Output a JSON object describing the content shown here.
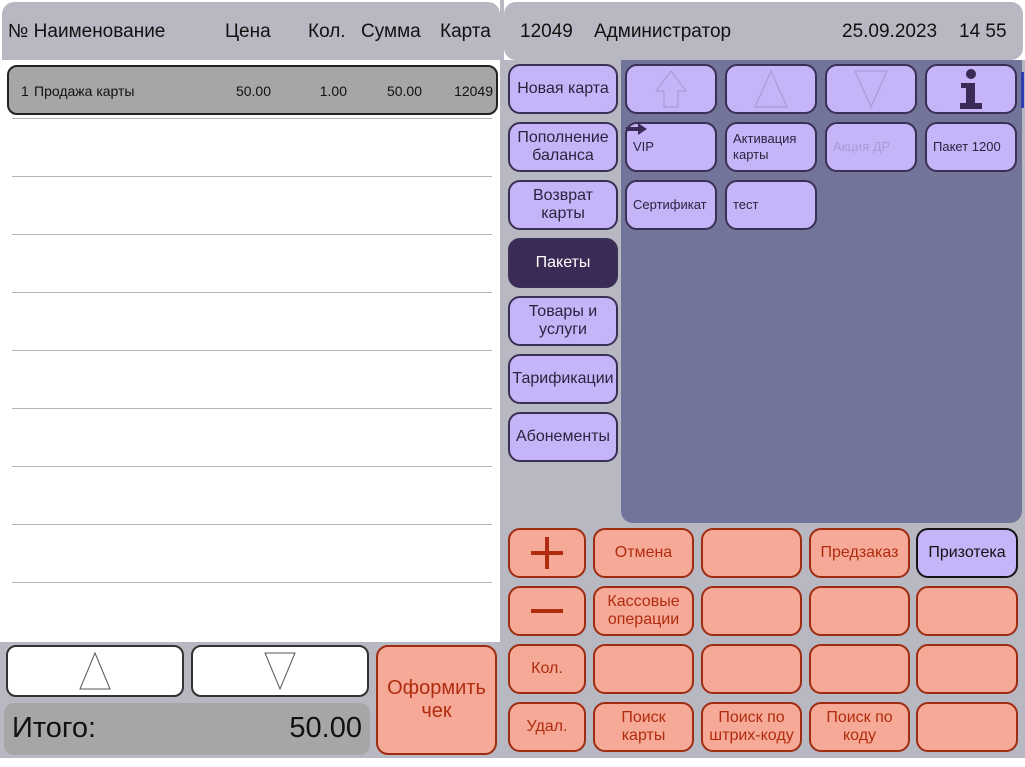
{
  "receipt": {
    "columns": {
      "number_name": "№ Наименование",
      "price": "Цена",
      "qty": "Кол.",
      "sum": "Сумма",
      "card": "Карта"
    },
    "rows": [
      {
        "no": "1",
        "name": "Продажа карты",
        "price": "50.00",
        "qty": "1.00",
        "sum": "50.00",
        "card": "12049"
      }
    ]
  },
  "total": {
    "label": "Итого:",
    "value": "50.00"
  },
  "checkout": {
    "label": "Оформить чек"
  },
  "header": {
    "id": "12049",
    "user": "Администратор",
    "date": "25.09.2023",
    "time": "14 55"
  },
  "categories": [
    {
      "label": "Новая карта"
    },
    {
      "label": "Пополнение баланса"
    },
    {
      "label": "Возврат карты"
    },
    {
      "label": "Пакеты",
      "active": true
    },
    {
      "label": "Товары и услуги"
    },
    {
      "label": "Тарификации"
    },
    {
      "label": "Абонементы"
    }
  ],
  "item_nav": {
    "up_level": "up-level-arrow-icon",
    "up": "up-triangle-icon",
    "down": "down-triangle-icon",
    "info": "info-icon"
  },
  "items": [
    {
      "label": "VIP",
      "marker": "arrow-right-icon"
    },
    {
      "label": "Активация карты"
    },
    {
      "label": "Акция ДР",
      "disabled": true
    },
    {
      "label": "Пакет 1200"
    },
    {
      "label": "Сертификат"
    },
    {
      "label": "тест"
    }
  ],
  "keypad": {
    "plus": "plus-icon",
    "minus": "minus-icon",
    "cancel": "Отмена",
    "preorder": "Предзаказ",
    "prizoteka": "Призотека",
    "cash_ops": "Кассовые операции",
    "qty": "Кол.",
    "delete": "Удал.",
    "search_card": "Поиск карты",
    "search_barcode": "Поиск по штрих-коду",
    "search_code": "Поиск по коду"
  },
  "colors": {
    "violet_button": "#c5b4f7",
    "active_button": "#3a2a55",
    "salmon_button": "#f6a996",
    "salmon_text": "#b02c0f",
    "panel_grey": "#b7b8c1",
    "items_panel": "#727599"
  }
}
